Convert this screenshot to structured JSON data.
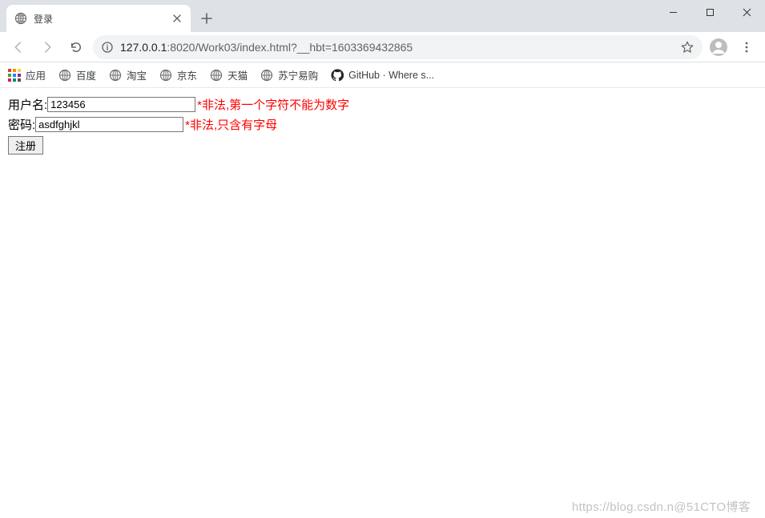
{
  "tab": {
    "title": "登录"
  },
  "window": {
    "minimize": "–",
    "maximize": "□",
    "close": "×"
  },
  "toolbar": {
    "url_host": "127.0.0.1",
    "url_port": ":8020",
    "url_path": "/Work03/index.html?__hbt=1603369432865"
  },
  "bookmarks": [
    {
      "label": "应用",
      "icon": "apps"
    },
    {
      "label": "百度",
      "icon": "globe"
    },
    {
      "label": "淘宝",
      "icon": "globe"
    },
    {
      "label": "京东",
      "icon": "globe"
    },
    {
      "label": "天猫",
      "icon": "globe"
    },
    {
      "label": "苏宁易购",
      "icon": "globe"
    },
    {
      "label": "GitHub · Where s...",
      "icon": "github"
    }
  ],
  "form": {
    "username_label": "用户名:",
    "username_value": "123456",
    "username_error": "*非法,第一个字符不能为数字",
    "password_label": "密码:",
    "password_value": "asdfghjkl",
    "password_error": "*非法,只含有字母",
    "submit_label": "注册"
  },
  "watermark": "https://blog.csdn.n@51CTO博客"
}
